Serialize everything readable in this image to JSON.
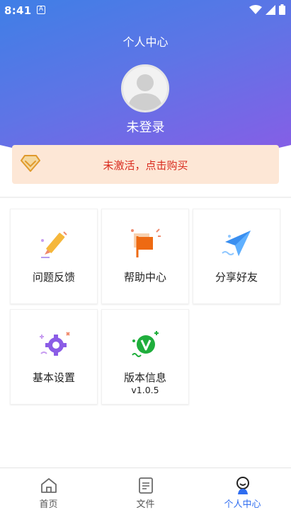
{
  "status_bar": {
    "time": "8:41",
    "notification_letter": "A"
  },
  "header": {
    "title": "个人中心"
  },
  "profile": {
    "login_text": "未登录"
  },
  "vip_banner": {
    "text": "未激活，点击购买"
  },
  "grid": {
    "items": [
      {
        "label": "问题反馈",
        "icon": "pencil-icon"
      },
      {
        "label": "帮助中心",
        "icon": "flag-icon"
      },
      {
        "label": "分享好友",
        "icon": "paper-plane-icon"
      },
      {
        "label": "基本设置",
        "icon": "gear-icon"
      },
      {
        "label": "版本信息",
        "sub": "v1.0.5",
        "icon": "version-v-icon"
      }
    ]
  },
  "tabs": [
    {
      "label": "首页",
      "icon": "home-icon",
      "active": false
    },
    {
      "label": "文件",
      "icon": "file-icon",
      "active": false
    },
    {
      "label": "个人中心",
      "icon": "profile-icon",
      "active": true
    }
  ],
  "colors": {
    "accent": "#2f6df0",
    "banner_text": "#d92b1e",
    "banner_bg": "#fde7d6"
  }
}
